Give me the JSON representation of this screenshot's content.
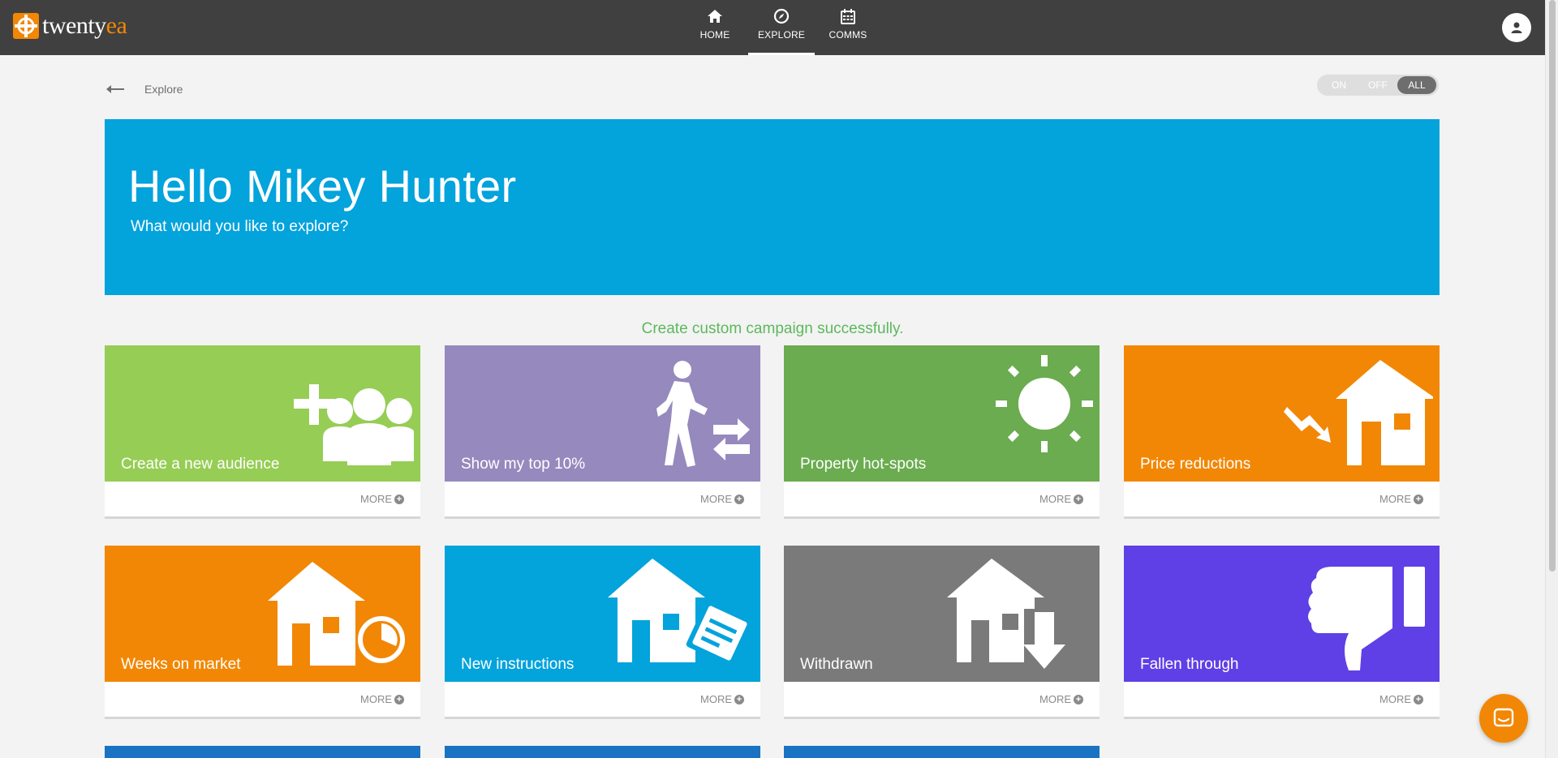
{
  "brand": {
    "name_main": "twenty",
    "name_accent": "ea",
    "accent_color": "#f28705"
  },
  "nav": {
    "items": [
      {
        "label": "HOME",
        "icon": "home-icon",
        "active": false
      },
      {
        "label": "EXPLORE",
        "icon": "compass-icon",
        "active": true
      },
      {
        "label": "COMMS",
        "icon": "calendar-icon",
        "active": false
      }
    ]
  },
  "breadcrumb": {
    "label": "Explore"
  },
  "toggle": {
    "options": [
      "ON",
      "OFF",
      "ALL"
    ],
    "selected": "ALL"
  },
  "hero": {
    "title": "Hello Mikey Hunter",
    "subtitle": "What would you like to explore?",
    "color": "#03a3dc"
  },
  "status": {
    "message": "Create custom campaign successfully."
  },
  "cards": [
    {
      "label": "Create a new audience",
      "more": "MORE",
      "color": "#96cd55",
      "icon": "add-audience-icon"
    },
    {
      "label": "Show my top 10%",
      "more": "MORE",
      "color": "#9689bd",
      "icon": "walking-person-swap-icon"
    },
    {
      "label": "Property hot-spots",
      "more": "MORE",
      "color": "#6aac4f",
      "icon": "sun-icon"
    },
    {
      "label": "Price reductions",
      "more": "MORE",
      "color": "#f28705",
      "icon": "house-price-down-icon"
    },
    {
      "label": "Weeks on market",
      "more": "MORE",
      "color": "#f28705",
      "icon": "house-clock-icon"
    },
    {
      "label": "New instructions",
      "more": "MORE",
      "color": "#03a3dc",
      "icon": "house-document-icon"
    },
    {
      "label": "Withdrawn",
      "more": "MORE",
      "color": "#7a7a7a",
      "icon": "house-down-arrow-icon"
    },
    {
      "label": "Fallen through",
      "more": "MORE",
      "color": "#5f40e6",
      "icon": "thumbs-down-icon"
    }
  ]
}
